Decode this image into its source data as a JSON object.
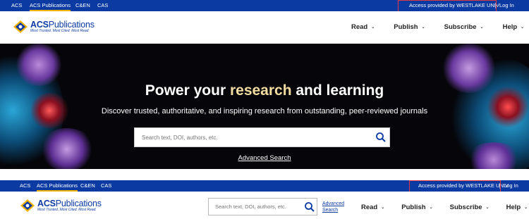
{
  "topnav": {
    "items": [
      "ACS",
      "ACS Publications",
      "C&EN",
      "CAS"
    ],
    "active": "ACS Publications",
    "access_text": "Access provided by WESTLAKE UNIV",
    "login_label": "Log In"
  },
  "logo": {
    "brand_bold": "ACS",
    "brand_rest": "Publications",
    "tagline": "Most Trusted. Most Cited. Most Read."
  },
  "mainnav": {
    "items": [
      {
        "label": "Read"
      },
      {
        "label": "Publish"
      },
      {
        "label": "Subscribe"
      },
      {
        "label": "Help"
      }
    ]
  },
  "hero": {
    "title_pre": "Power your ",
    "title_highlight": "research",
    "title_post": " and learning",
    "subtitle": "Discover trusted, authoritative, and inspiring research from outstanding, peer-reviewed journals",
    "search_placeholder": "Search text, DOI, authors, etc.",
    "advanced_search": "Advanced Search"
  },
  "sticky_header": {
    "search_placeholder": "Search text, DOI, authors, etc.",
    "advanced_search": "Advanced Search"
  },
  "colors": {
    "brand_blue": "#0b3aa3",
    "active_underline": "#f0b400",
    "highlight_box": "#e0393e"
  },
  "icons": [
    "search-icon",
    "chevron-down-icon",
    "acs-logo-mark"
  ]
}
